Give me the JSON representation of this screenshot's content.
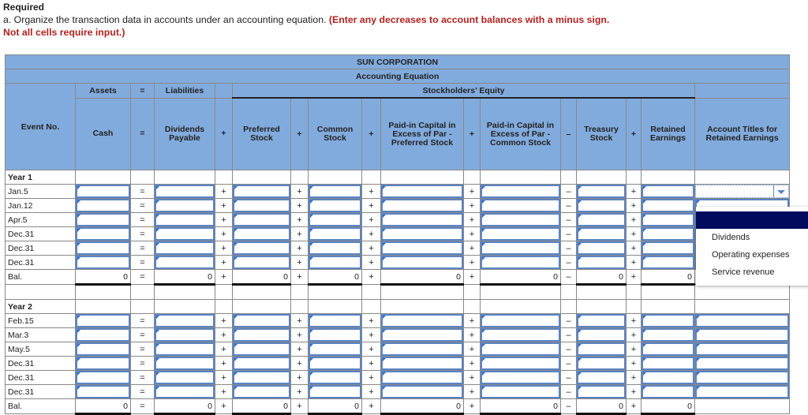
{
  "required_label": "Required",
  "instruction": "a. Organize the transaction data in accounts under an accounting equation.",
  "instruction_note": "(Enter any decreases to account balances with a minus sign. Not all cells require input.)",
  "table": {
    "company": "SUN CORPORATION",
    "subtitle": "Accounting Equation",
    "groups": {
      "assets": "Assets",
      "eq": "=",
      "liabilities": "Liabilities",
      "equity": "Stockholders’ Equity"
    },
    "event_header": "Event No.",
    "columns": [
      "Cash",
      "=",
      "Dividends Payable",
      "+",
      "Preferred Stock",
      "+",
      "Common Stock",
      "+",
      "Paid-in Capital in Excess of Par - Preferred Stock",
      "+",
      "Paid-in Capital in Excess of Par - Common Stock",
      "–",
      "Treasury Stock",
      "+",
      "Retained Earnings",
      "Account Titles for Retained Earnings"
    ],
    "operators": [
      "=",
      "+",
      "+",
      "+",
      "+",
      "–",
      "+"
    ],
    "sections": [
      {
        "label": "Year 1",
        "events": [
          "Jan.5",
          "Jan.12",
          "Apr.5",
          "Dec.31",
          "Dec.31",
          "Dec.31"
        ],
        "balance_label": "Bal.",
        "balances": [
          "0",
          "0",
          "0",
          "0",
          "0",
          "0",
          "0",
          "0"
        ]
      },
      {
        "label": "Year 2",
        "events": [
          "Feb.15",
          "Mar.3",
          "May.5",
          "Dec.31",
          "Dec.31",
          "Dec.31"
        ],
        "balance_label": "Bal.",
        "balances": [
          "0",
          "0",
          "0",
          "0",
          "0",
          "0",
          "0",
          "0"
        ]
      }
    ]
  },
  "dropdown": {
    "selected": "",
    "options": [
      "Dividends",
      "Operating expenses",
      "Service revenue"
    ]
  }
}
